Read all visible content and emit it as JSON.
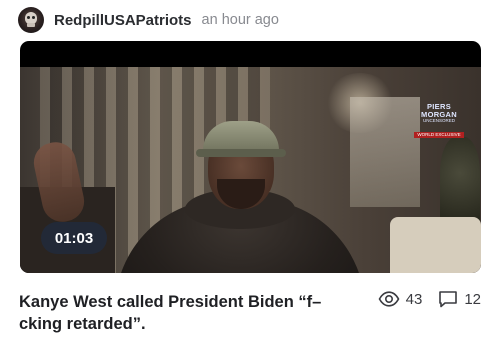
{
  "post": {
    "author": "RedpillUSAPatriots",
    "time": "an hour ago",
    "avatar_icon": "skull-avatar",
    "video": {
      "duration": "01:03",
      "overlay_logo": {
        "line1": "PIERS",
        "line2": "MORGAN",
        "line3": "UNCENSORED",
        "line4": "WORLD EXCLUSIVE"
      }
    },
    "title": "Kanye West called President Biden “f–cking retarded”.",
    "views": "43",
    "comments": "12",
    "icons": {
      "views": "eye-icon",
      "comments": "comment-icon"
    }
  }
}
